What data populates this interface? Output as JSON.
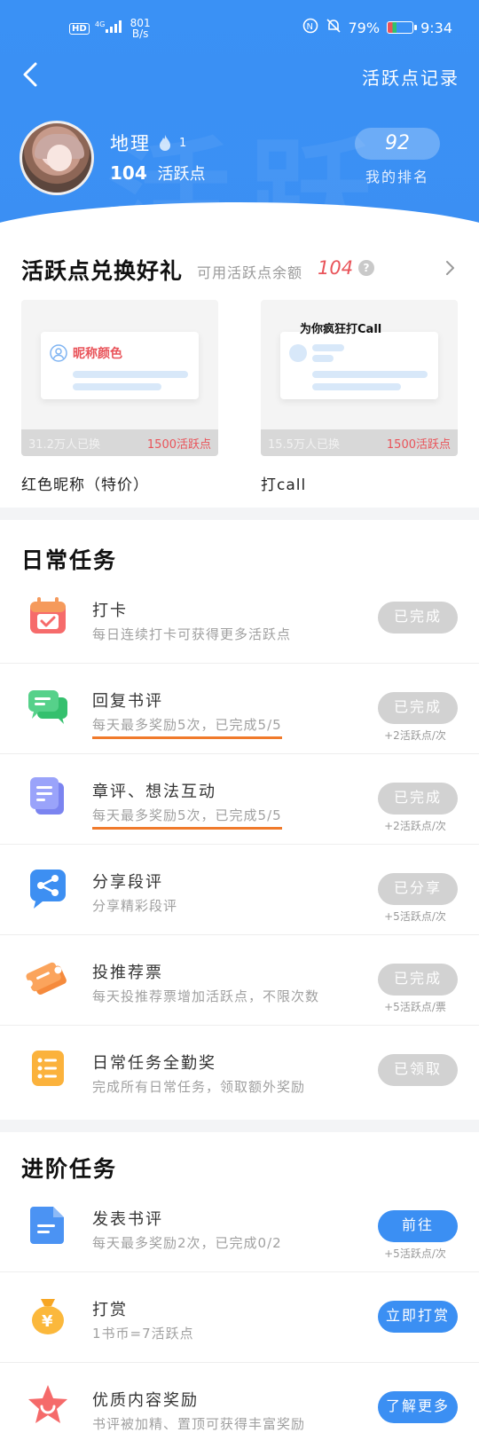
{
  "statusbar": {
    "hd": "HD",
    "signal": "4G",
    "net_speed": "801",
    "net_unit": "B/s",
    "battery": "79%",
    "time": "9:34"
  },
  "header": {
    "record_link": "活跃点记录",
    "username": "地理",
    "level": "1",
    "points_value": "104",
    "points_label": "活跃点",
    "rank_value": "92",
    "rank_label": "我的排名"
  },
  "gift": {
    "title": "活跃点兑换好礼",
    "available_label": "可用活跃点余额",
    "balance": "104",
    "help": "?",
    "cards": [
      {
        "name": "红色昵称（特价）",
        "preview_text": "昵称颜色",
        "swapped": "31.2万人已换",
        "cost": "1500活跃点"
      },
      {
        "name": "打call",
        "preview_text": "为你疯狂打Call",
        "swapped": "15.5万人已换",
        "cost": "1500活跃点"
      }
    ]
  },
  "daily": {
    "title": "日常任务",
    "tasks": [
      {
        "name": "打卡",
        "desc": "每日连续打卡可获得更多活跃点",
        "button": "已完成",
        "reward": ""
      },
      {
        "name": "回复书评",
        "desc": "每天最多奖励5次，已完成5/5",
        "button": "已完成",
        "reward": "+2活跃点/次"
      },
      {
        "name": "章评、想法互动",
        "desc": "每天最多奖励5次，已完成5/5",
        "button": "已完成",
        "reward": "+2活跃点/次"
      },
      {
        "name": "分享段评",
        "desc": "分享精彩段评",
        "button": "已分享",
        "reward": "+5活跃点/次"
      },
      {
        "name": "投推荐票",
        "desc": "每天投推荐票增加活跃点，不限次数",
        "button": "已完成",
        "reward": "+5活跃点/票"
      },
      {
        "name": "日常任务全勤奖",
        "desc": "完成所有日常任务，领取额外奖励",
        "button": "已领取",
        "reward": ""
      }
    ]
  },
  "advanced": {
    "title": "进阶任务",
    "tasks": [
      {
        "name": "发表书评",
        "desc": "每天最多奖励2次，已完成0/2",
        "button": "前往",
        "reward": "+5活跃点/次"
      },
      {
        "name": "打赏",
        "desc": "1书币=7活跃点",
        "button": "立即打赏",
        "reward": ""
      },
      {
        "name": "优质内容奖励",
        "desc": "书评被加精、置顶可获得丰富奖励",
        "button": "了解更多",
        "reward": ""
      }
    ]
  },
  "colors": {
    "brand_blue": "#3b8ff3",
    "accent_red": "#e9545a",
    "underline_orange": "#f07a2b",
    "done_gray": "#d2d2d2"
  }
}
